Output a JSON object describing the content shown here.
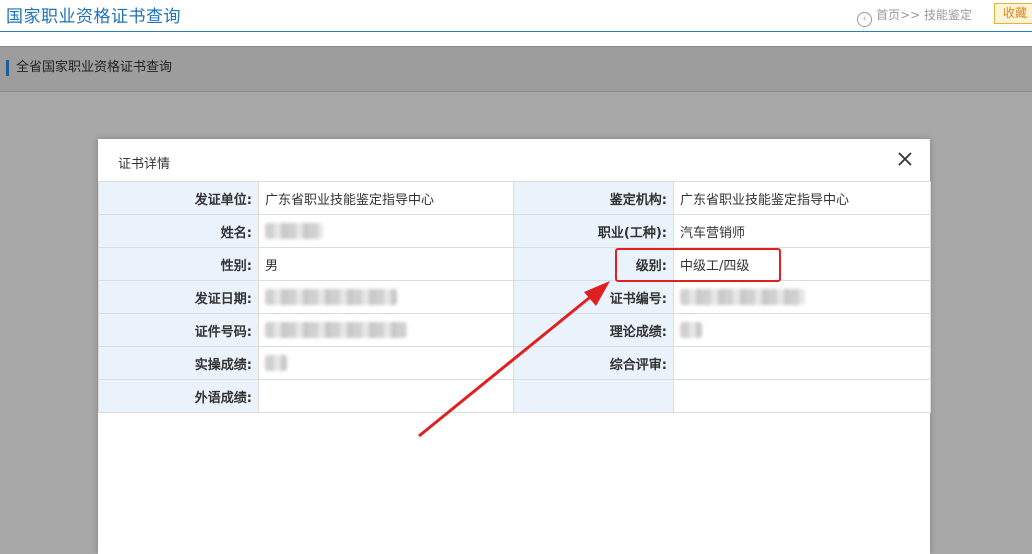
{
  "header": {
    "site_title": "国家职业资格证书查询",
    "breadcrumb": "首页>> 技能鉴定",
    "favorite_label": "收藏"
  },
  "section": {
    "title": "全省国家职业资格证书查询"
  },
  "modal": {
    "title": "证书详情",
    "rows": [
      {
        "l1": "发证单位:",
        "v1": "广东省职业技能鉴定指导中心",
        "l2": "鉴定机构:",
        "v2": "广东省职业技能鉴定指导中心"
      },
      {
        "l1": "姓名:",
        "v1": "",
        "l2": "职业(工种):",
        "v2": "汽车营销师"
      },
      {
        "l1": "性别:",
        "v1": "男",
        "l2": "级别:",
        "v2": "中级工/四级"
      },
      {
        "l1": "发证日期:",
        "v1": "",
        "l2": "证书编号:",
        "v2": ""
      },
      {
        "l1": "证件号码:",
        "v1": "",
        "l2": "理论成绩:",
        "v2": ""
      },
      {
        "l1": "实操成绩:",
        "v1": "",
        "l2": "综合评审:",
        "v2": ""
      },
      {
        "l1": "外语成绩:",
        "v1": "",
        "l2": "",
        "v2": ""
      }
    ]
  },
  "colors": {
    "title_blue": "#1d72b8",
    "label_bg": "#eaf2fb",
    "annotation_red": "#e02020"
  }
}
